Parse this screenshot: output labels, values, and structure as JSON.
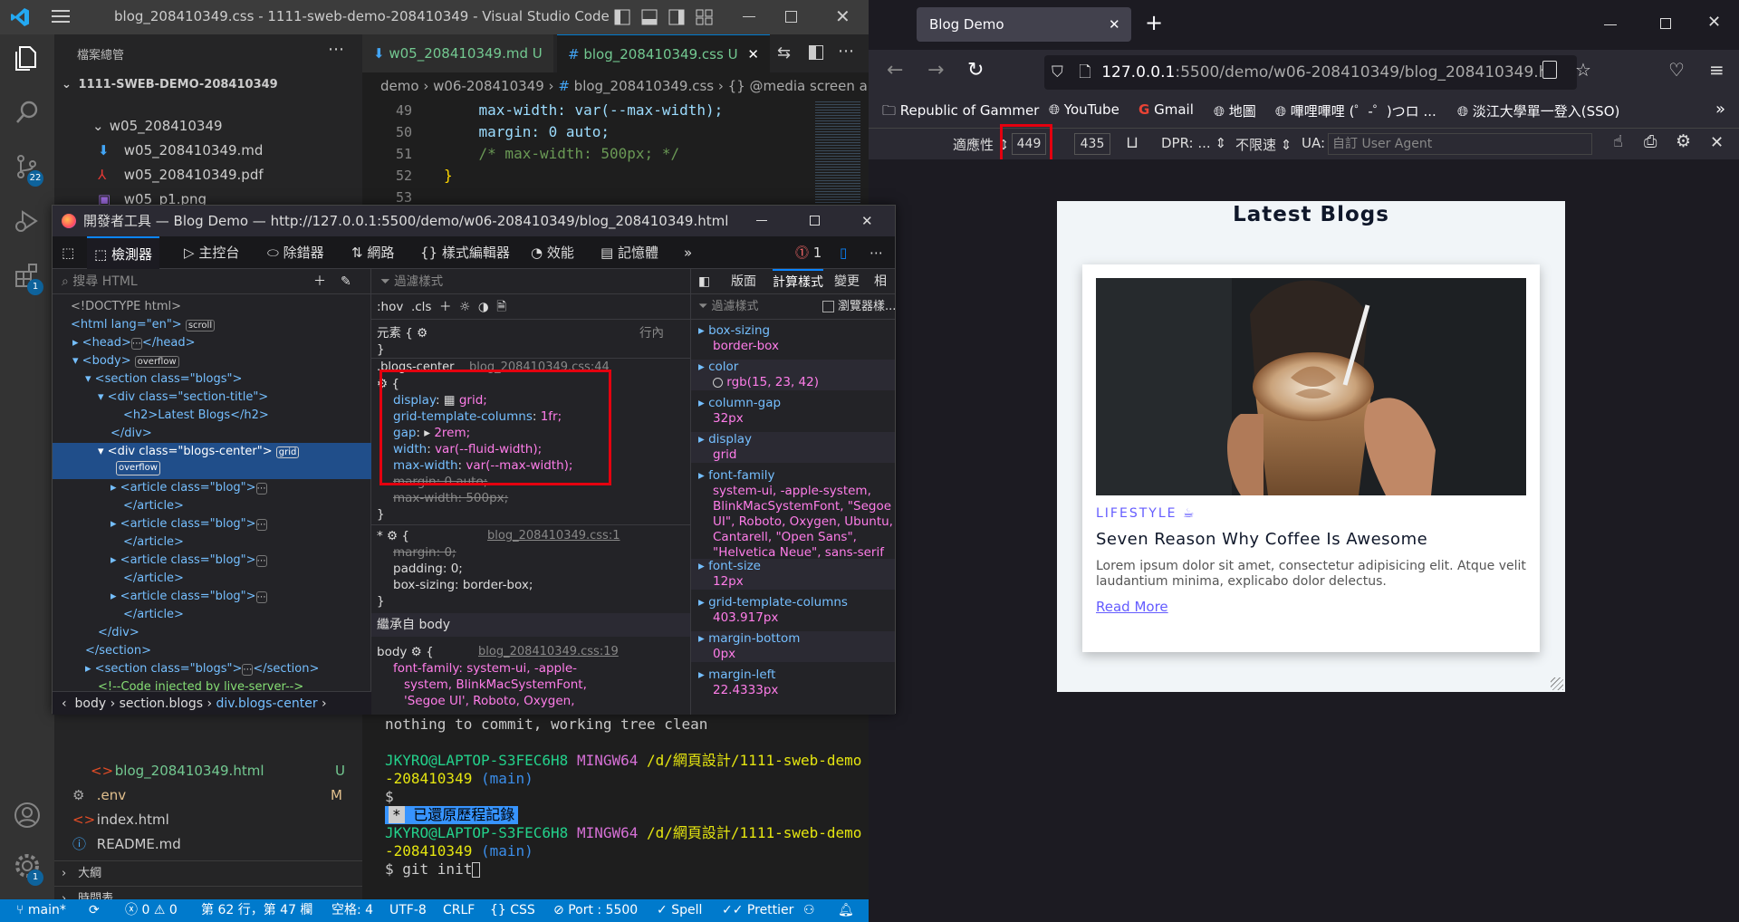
{
  "vscode": {
    "window_title": "blog_208410349.css - 1111-sweb-demo-208410349 - Visual Studio Code",
    "explorer_title": "檔案總管",
    "project": "1111-SWEB-DEMO-208410349",
    "tree": [
      {
        "label": "w05_208410349",
        "kind": "folder"
      },
      {
        "label": "w05_208410349.md",
        "kind": "md"
      },
      {
        "label": "w05_208410349.pdf",
        "kind": "pdf"
      },
      {
        "label": "w05_p1.png",
        "kind": "png"
      }
    ],
    "tree_bottom": [
      {
        "label": "blog_208410349.html",
        "mark": "U"
      },
      {
        "label": ".env",
        "mark": "M"
      },
      {
        "label": "index.html",
        "mark": ""
      },
      {
        "label": "README.md",
        "mark": ""
      }
    ],
    "panels": [
      "大綱",
      "時間表"
    ],
    "scm_badge": "22",
    "ext_badge": "1",
    "acct_badge": "1",
    "tabs": [
      {
        "label": "w05_208410349.md",
        "mark": "U"
      },
      {
        "label": "blog_208410349.css",
        "mark": "U"
      }
    ],
    "breadcrumb": [
      "demo",
      "w06-208410349",
      "blog_208410349.css",
      "@media screen an"
    ],
    "code": [
      {
        "n": "49",
        "text": "    max-width: var(--max-width);"
      },
      {
        "n": "50",
        "text": "    margin: 0 auto;"
      },
      {
        "n": "51",
        "text": "    /* max-width: 500px; */"
      },
      {
        "n": "52",
        "text": "}"
      },
      {
        "n": "53",
        "text": ""
      }
    ],
    "terminal": {
      "line1": "nothing to commit, working tree clean",
      "user": "JKYRO@LAPTOP-S3FEC6H8",
      "shell": "MINGW64",
      "path1": "/d/網頁設計/1111-sweb-demo",
      "path2": "-208410349",
      "branch": "(main)",
      "prompt": "$",
      "restored": "已還原歷程記錄",
      "cmd": "$ git init"
    },
    "status": {
      "branch": "main*",
      "errors": "0",
      "warnings": "0",
      "position": "第 62 行，第 47 欄",
      "spaces": "空格: 4",
      "encoding": "UTF-8",
      "eol": "CRLF",
      "lang": "CSS",
      "port": "Port : 5500",
      "spell": "Spell",
      "prettier": "Prettier"
    }
  },
  "devtools": {
    "title": "開發者工具 — Blog Demo — http://127.0.0.1:5500/demo/w06-208410349/blog_208410349.html",
    "tabs": [
      "檢測器",
      "主控台",
      "除錯器",
      "網路",
      "樣式編輯器",
      "效能",
      "記憶體"
    ],
    "error_count": "1",
    "search_placeholder": "搜尋 HTML",
    "filter_placeholder": "過濾樣式",
    "pseudo": ":hov",
    "cls": ".cls",
    "element_label": "元素",
    "inline_label": "行內",
    "inherited_label": "繼承自 body",
    "rule1_selector": ".blogs-center",
    "rule1_source": "blog_208410349.css:44",
    "rule1_props": [
      {
        "p": "display",
        "v": "grid;"
      },
      {
        "p": "grid-template-columns",
        "v": "1fr;"
      },
      {
        "p": "gap",
        "v": "2rem;"
      },
      {
        "p": "width",
        "v": "var(--fluid-width);"
      },
      {
        "p": "max-width",
        "v": "var(--max-width);"
      }
    ],
    "rule1_struck": [
      "margin: 0 auto;",
      "max-width: 500px;"
    ],
    "rule2_source": "blog_208410349.css:1",
    "rule2_props": [
      "margin: 0;",
      "padding: 0;",
      "box-sizing: border-box;"
    ],
    "rule3_source": "blog_208410349.css:19",
    "rule3_lines": [
      "font-family: system-ui, -apple-",
      "system, BlinkMacSystemFont,",
      "'Segoe UI', Roboto, Oxygen,"
    ],
    "comp_tabs": [
      "版面",
      "計算樣式",
      "變更",
      "相"
    ],
    "browser_styles": "瀏覽器樣...",
    "computed": [
      {
        "p": "box-sizing",
        "v": "border-box"
      },
      {
        "p": "color",
        "v": "rgb(15, 23, 42)"
      },
      {
        "p": "column-gap",
        "v": "32px"
      },
      {
        "p": "display",
        "v": "grid"
      },
      {
        "p": "font-family",
        "v": "system-ui, -apple-system, BlinkMacSystemFont, \"Segoe UI\", Roboto, Oxygen, Ubuntu, Cantarell, \"Open Sans\", \"Helvetica Neue\", sans-serif"
      },
      {
        "p": "font-size",
        "v": "12px"
      },
      {
        "p": "grid-template-columns",
        "v": "403.917px"
      },
      {
        "p": "margin-bottom",
        "v": "0px"
      },
      {
        "p": "margin-left",
        "v": "22.4333px"
      }
    ],
    "html_tree": [
      "<!DOCTYPE html>",
      "<html lang=\"en\">",
      "<head>",
      "<body>",
      "<section class=\"blogs\">",
      "<div class=\"section-title\">",
      "<h2>Latest Blogs</h2>",
      "</div>",
      "<div class=\"blogs-center\">",
      "<article class=\"blog\">",
      "</article>",
      "</section>",
      "<!--Code injected by live-server-->"
    ],
    "badges": {
      "scroll": "scroll",
      "overflow": "overflow",
      "grid": "grid"
    },
    "crumbs": [
      "body",
      "section.blogs",
      "div.blogs-center"
    ]
  },
  "firefox": {
    "tab_title": "Blog Demo",
    "url_host": "127.0.0.1",
    "url_rest": ":5500/demo/w06-208410349/blog_208410349.h",
    "bookmarks": [
      "Republic of Gammer",
      "YouTube",
      "Gmail",
      "地圖",
      "嗶哩嗶哩 (゜-゜)つロ ...",
      "淡江大學單一登入(SSO)"
    ],
    "rdm": {
      "device": "適應性",
      "width": "449",
      "height": "435",
      "dpr": "DPR: ...",
      "throttle": "不限速",
      "ua_label": "UA:",
      "ua_placeholder": "自訂 User Agent"
    },
    "page": {
      "heading": "Latest Blogs",
      "category": "LIFESTYLE",
      "title": "Seven Reason Why Coffee Is Awesome",
      "text": "Lorem ipsum dolor sit amet, consectetur adipisicing elit. Atque velit laudantium minima, explicabo dolor delectus.",
      "link": "Read More"
    }
  }
}
